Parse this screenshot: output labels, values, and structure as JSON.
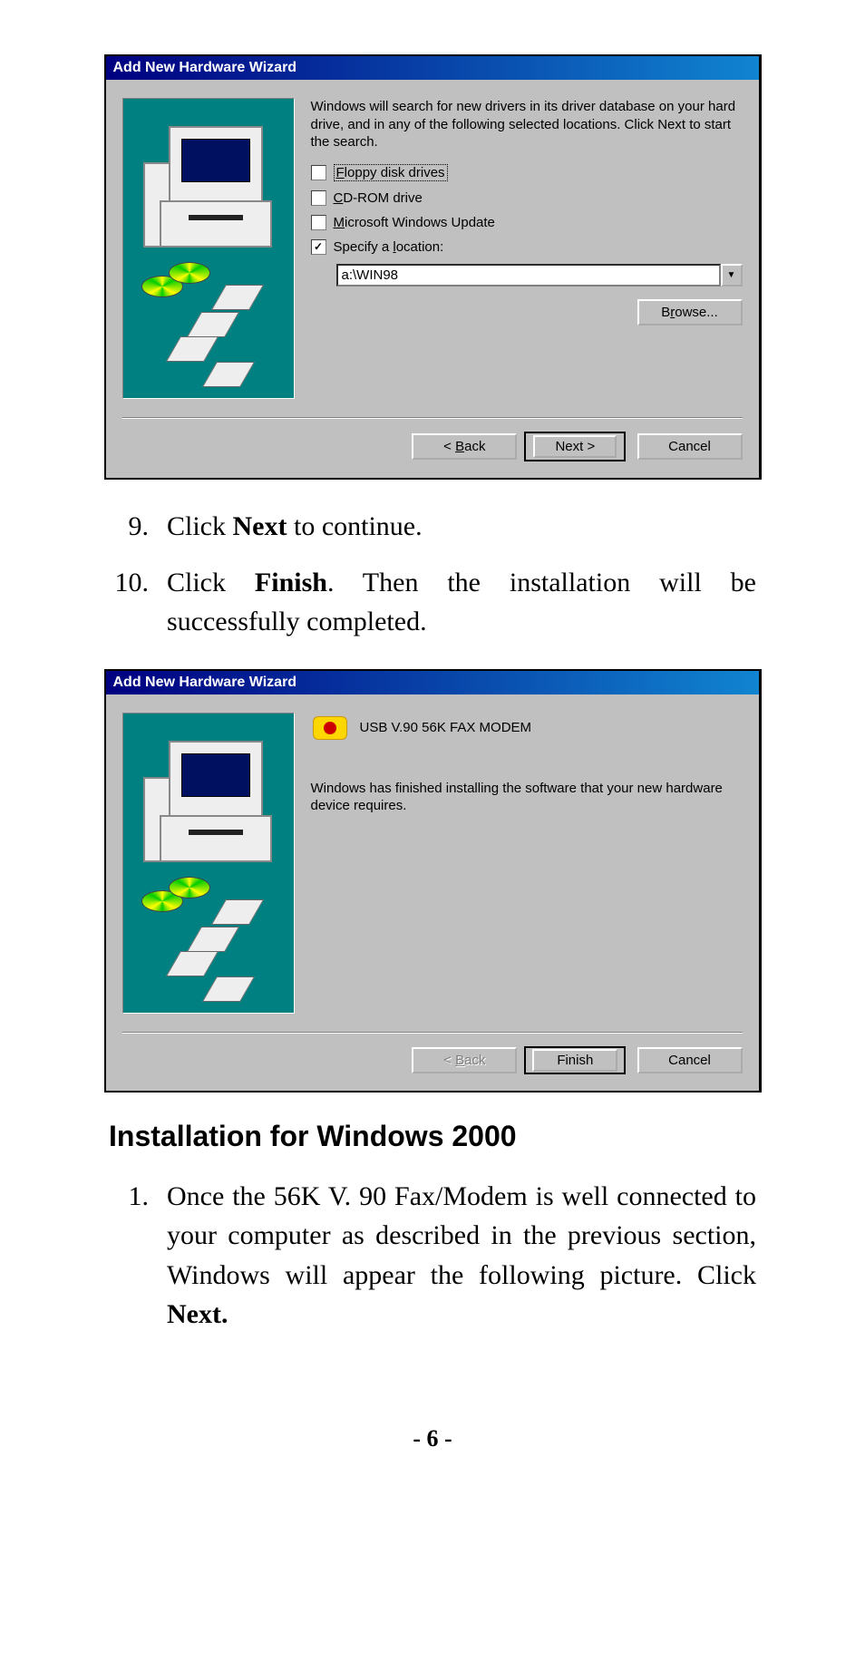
{
  "dialog1": {
    "title": "Add New Hardware Wizard",
    "intro": "Windows will search for new drivers in its driver database on your hard drive, and in any of the following selected locations. Click Next to start the search.",
    "opt_floppy_pre": "F",
    "opt_floppy_post": "loppy disk drives",
    "opt_cd_pre": "C",
    "opt_cd_post": "D-ROM drive",
    "opt_msupdate_pre": "M",
    "opt_msupdate_post": "icrosoft Windows Update",
    "opt_specify_pre": "Specify a ",
    "opt_specify_u": "l",
    "opt_specify_post": "ocation:",
    "location_value": "a:\\WIN98",
    "browse_pre": "B",
    "browse_u": "r",
    "browse_post": "owse...",
    "back_pre": "< ",
    "back_u": "B",
    "back_post": "ack",
    "next": "Next >",
    "cancel": "Cancel"
  },
  "step9_pre": "Click ",
  "step9_bold": "Next",
  "step9_post": " to continue.",
  "step10_pre": "Click ",
  "step10_bold": "Finish",
  "step10_post": ".  Then the installation will be successfully completed.",
  "dialog2": {
    "title": "Add New Hardware Wizard",
    "device": "USB V.90 56K FAX MODEM",
    "finished": "Windows has finished installing the software that your new hardware device requires.",
    "back_pre": "< ",
    "back_u": "B",
    "back_post": "ack",
    "finish": "Finish",
    "cancel": "Cancel"
  },
  "section_heading": "Installation for Windows 2000",
  "w2k_step1_pre": "Once the 56K V. 90 Fax/Modem is well connected to your computer as described in the previous section, Windows will appear the following picture.  Click ",
  "w2k_step1_bold": "Next.",
  "page_number": "- 6 -"
}
